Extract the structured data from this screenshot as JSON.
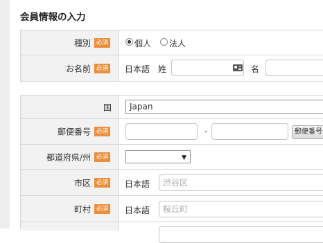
{
  "page": {
    "title": "会員情報の入力"
  },
  "required_badge": "必須",
  "form1": {
    "type": {
      "label": "種別",
      "options": [
        "個人",
        "法人"
      ],
      "selected": "個人"
    },
    "name": {
      "label": "お名前",
      "lang": "日本語",
      "last_label": "姓",
      "first_label": "名",
      "last_value": "",
      "first_value": ""
    }
  },
  "form2": {
    "country": {
      "label": "国",
      "value": "Japan"
    },
    "postal": {
      "label": "郵便番号",
      "part1": "",
      "separator": "-",
      "part2": "",
      "lookup_button": "郵便番号から住所"
    },
    "prefecture": {
      "label": "都道府県/州",
      "value": ""
    },
    "city": {
      "label": "市区",
      "lang": "日本語",
      "placeholder": "渋谷区"
    },
    "town": {
      "label": "町村",
      "lang": "日本語",
      "placeholder": "桜丘町"
    }
  },
  "icons": {
    "name_field": "contact-card-icon",
    "select_arrow": "dropdown-arrow-icon"
  }
}
